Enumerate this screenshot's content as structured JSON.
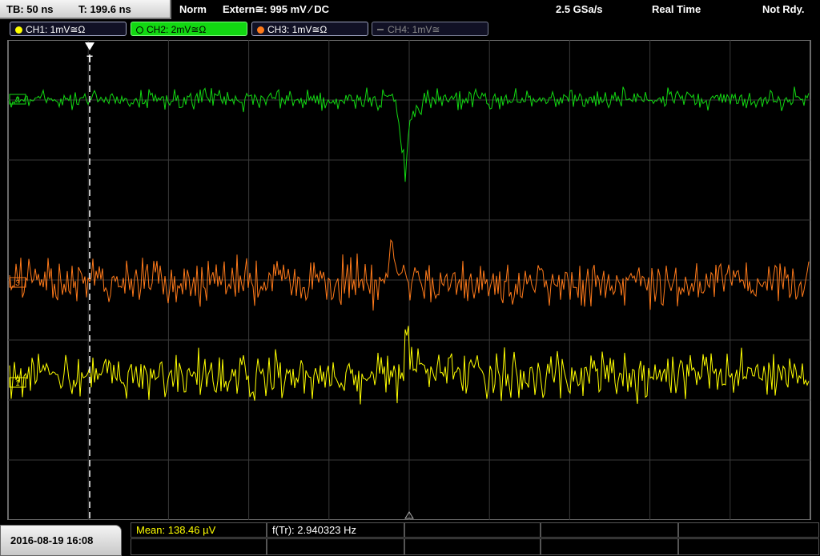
{
  "status": {
    "timebase": "TB: 50 ns",
    "trigger_time": "T: 199.6 ns",
    "mode": "Norm",
    "trigger_source": "Extern≅: 995 mV ⁄ DC",
    "sample_rate": "2.5 GSa/s",
    "acq_mode": "Real Time",
    "ready_state": "Not Rdy."
  },
  "channels": [
    {
      "label": "CH1: 1mV≅Ω",
      "color": "#ffff00",
      "active": true
    },
    {
      "label": "CH2: 2mV≅Ω",
      "color": "#12d812",
      "active": true,
      "selected": true
    },
    {
      "label": "CH3: 1mV≅Ω",
      "color": "#ff7a1a",
      "active": true
    },
    {
      "label": "CH4: 1mV≅",
      "color": "#777777",
      "active": false
    }
  ],
  "markers": {
    "ch1": "1",
    "ch2": "2",
    "ch3": "3",
    "trigger": "T"
  },
  "footer": {
    "datetime": "2016-08-19 16:08",
    "mean_label": "Mean: 138.46 µV",
    "freq_label": "f(Tr): 2.940323 Hz"
  },
  "colors": {
    "grid": "#3a3a3a",
    "ch1": "#ffff00",
    "ch2": "#12d812",
    "ch3": "#ff7a1a"
  }
}
